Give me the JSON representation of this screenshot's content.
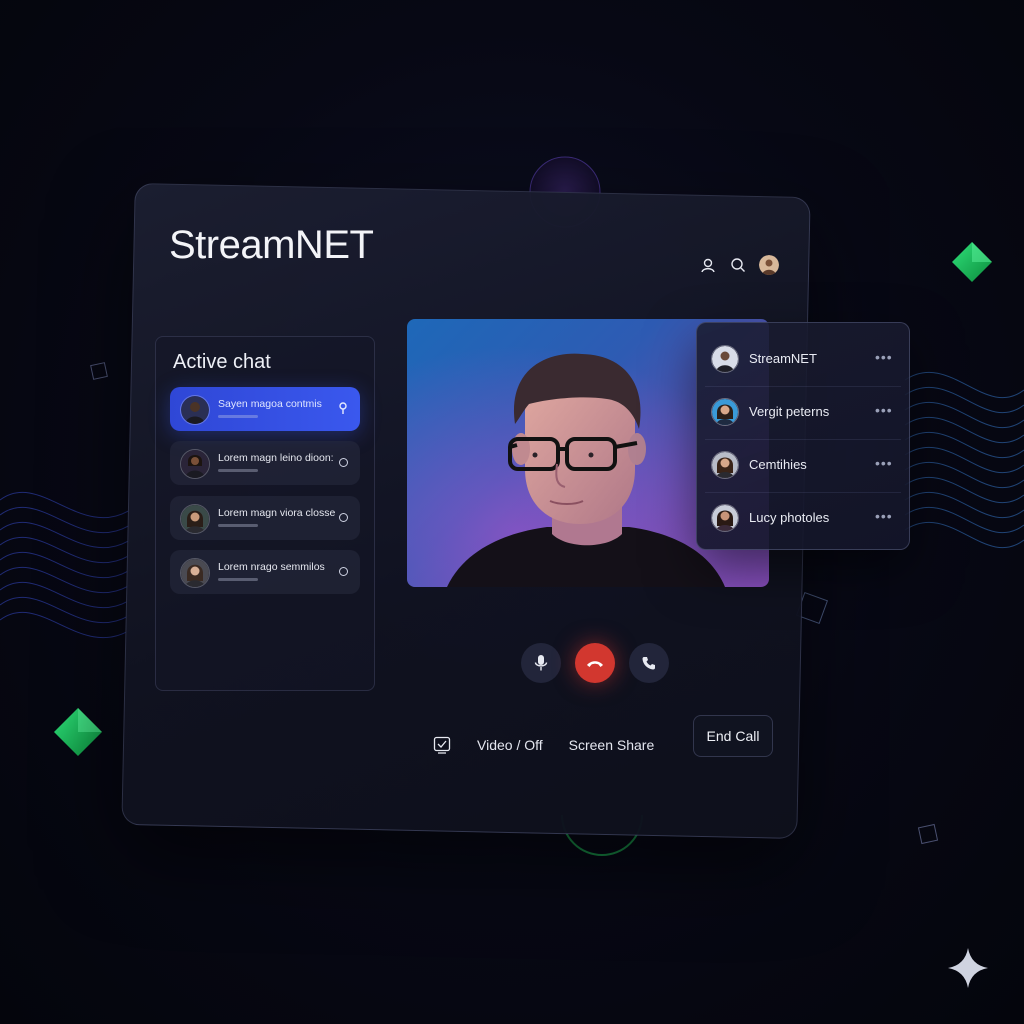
{
  "app": {
    "title": "StreamNET"
  },
  "header": {
    "icons": [
      "user-icon",
      "search-icon",
      "profile-avatar"
    ]
  },
  "chat": {
    "title": "Active chat",
    "items": [
      {
        "text": "Sayen magoa contmis",
        "active": true,
        "status": "pin"
      },
      {
        "text": "Lorem magn leino dioon:",
        "active": false,
        "status": "ring"
      },
      {
        "text": "Lorem magn viora closse",
        "active": false,
        "status": "ring"
      },
      {
        "text": "Lorem nrago semmilos",
        "active": false,
        "status": "ring"
      }
    ]
  },
  "controls": {
    "mic": "microphone-icon",
    "end": "hang-up-icon",
    "call": "phone-icon"
  },
  "bottom": {
    "video_label": "Video / Off",
    "screen_share_label": "Screen Share",
    "end_call_label": "End Call"
  },
  "contacts": [
    {
      "name": "StreamNET"
    },
    {
      "name": "Vergit peterns"
    },
    {
      "name": "Cemtihies"
    },
    {
      "name": "Lucy photoles"
    }
  ],
  "colors": {
    "accent": "#3a58ee",
    "end_call": "#d2372f",
    "gem": "#1fbf5a",
    "background": "#05060f"
  }
}
